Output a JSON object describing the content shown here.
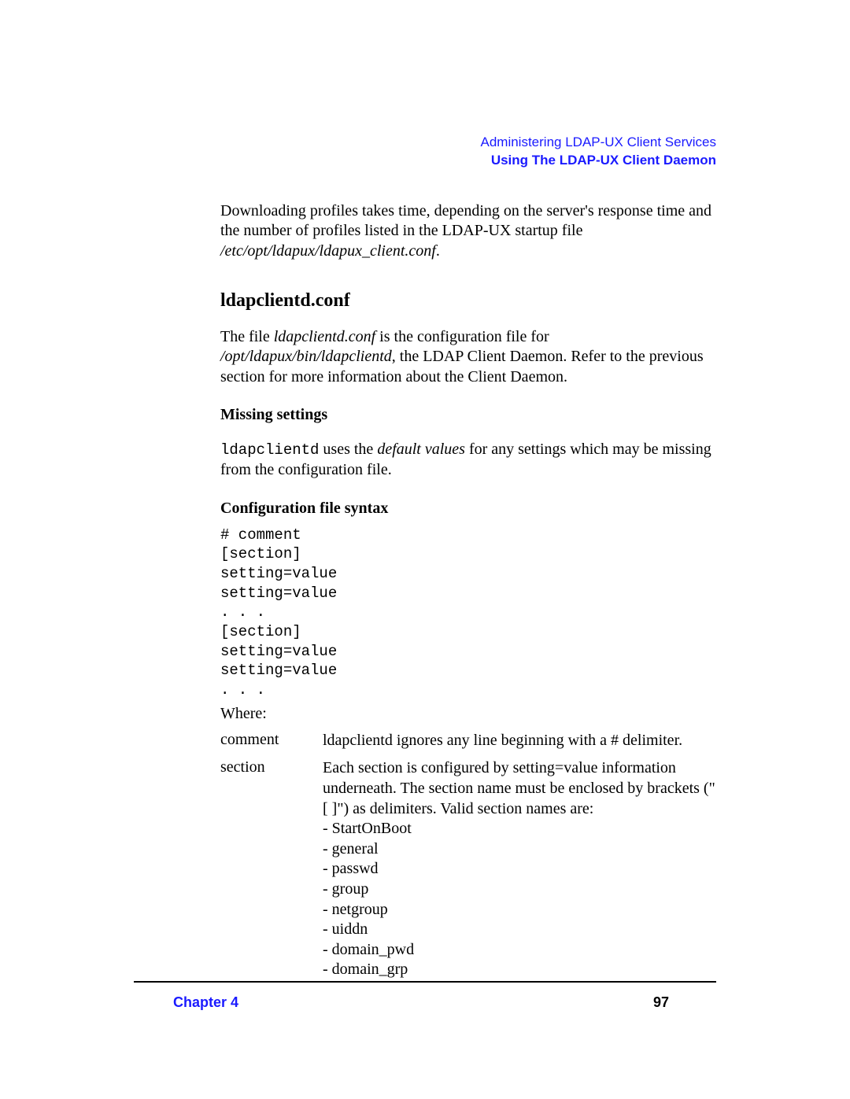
{
  "header": {
    "line1": "Administering LDAP-UX Client Services",
    "line2": "Using The LDAP-UX Client Daemon"
  },
  "intro": {
    "text_before_italic": "Downloading profiles takes time, depending on the server's response time and the number of profiles listed in the LDAP-UX startup file ",
    "italic_path": "/etc/opt/ldapux/ldapux_client.conf",
    "text_after_italic": "."
  },
  "section_heading": "ldapclientd.conf",
  "section_intro": {
    "p1_before": "The file ",
    "p1_italic1": "ldapclientd.conf",
    "p1_mid": " is the configuration file for ",
    "p1_italic2": "/opt/ldapux/bin/ldapclientd",
    "p1_after": ", the LDAP Client Daemon. Refer to the previous section for more information about the Client Daemon."
  },
  "missing": {
    "heading": "Missing settings",
    "p_mono": "ldapclientd",
    "p_mid": " uses the ",
    "p_italic": "default values",
    "p_after": " for any settings which may be missing from the configuration file."
  },
  "syntax": {
    "heading": "Configuration file syntax",
    "code": "# comment\n[section]\nsetting=value\nsetting=value\n. . .\n[section]\nsetting=value\nsetting=value\n. . .",
    "where": "Where:",
    "defs": [
      {
        "term": "comment",
        "lines": [
          "ldapclientd ignores any line beginning with a # delimiter."
        ]
      },
      {
        "term": "section",
        "lines": [
          "Each section is configured by setting=value information underneath. The section name must be enclosed by brackets (\"[ ]\") as delimiters. Valid section names are:",
          "- StartOnBoot",
          "- general",
          "- passwd",
          "- group",
          "- netgroup",
          "- uiddn",
          "- domain_pwd",
          "- domain_grp"
        ]
      }
    ]
  },
  "footer": {
    "chapter": "Chapter 4",
    "page": "97"
  }
}
